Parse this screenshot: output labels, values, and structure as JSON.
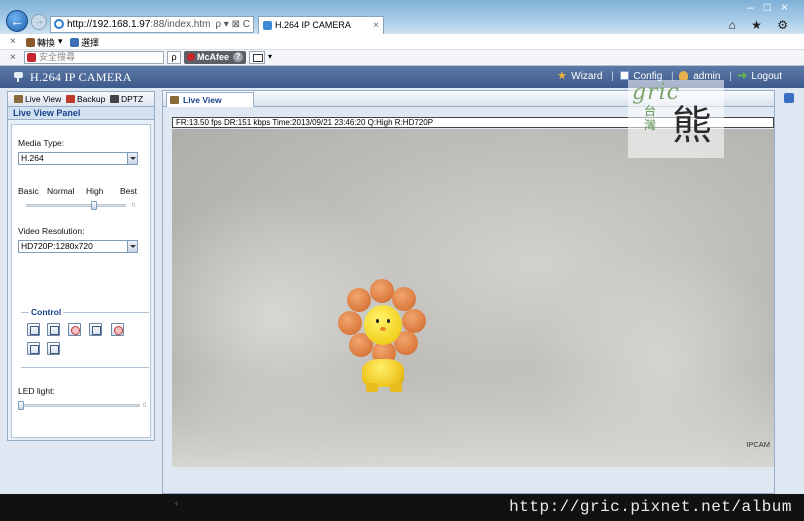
{
  "browser": {
    "address_url": "http://192.168.1.97:88/index.htm",
    "address_host": "http://192.168.1.97",
    "address_rest": ":88/index.htm",
    "address_tools": "ρ ▾ ⊠ C",
    "tab_title": "H.264 IP CAMERA",
    "tab_close": "×",
    "window_controls": {
      "minimize": "–",
      "maximize": "□",
      "close": "×"
    },
    "toolbar_icons": "⌂ ★ ⚙",
    "bar1": {
      "close": "×",
      "item1": "轉換",
      "item2": "選擇",
      "item1_dropdown": "▾"
    },
    "bar2": {
      "close": "×",
      "search_placeholder": "安全搜尋",
      "search_glyph": "ρ",
      "mcafee_label": "McAfee",
      "mcafee_help": "?",
      "dropdown": "▾"
    }
  },
  "app": {
    "title": "H.264 IP CAMERA",
    "header_links": {
      "wizard": "Wizard",
      "config": "Config",
      "admin": "admin",
      "logout": "Logout",
      "sep": "|"
    }
  },
  "left_panel": {
    "tabs": [
      "Live View",
      "Backup",
      "DPTZ"
    ],
    "title": "Live View Panel",
    "media_type_label": "Media Type:",
    "media_type_value": "H.264",
    "quality_labels": [
      "Basic",
      "Normal",
      "High",
      "Best"
    ],
    "quality_level": "High",
    "slider_end": "0",
    "video_resolution_label": "Video Resolution:",
    "video_resolution_value": "HD720P:1280x720",
    "control_legend": "Control",
    "led_label": "LED light:",
    "led_level": 0
  },
  "right_panel": {
    "tab": "Live View",
    "status": "FR:13.50 fps  DR:151 kbps Time:2013/09/21 23:46:20 Q:High R:HD720P",
    "cam_label": "IPCAM"
  },
  "watermark": {
    "gric": "gric",
    "taiwan": "台灣",
    "bear": "熊"
  },
  "footer": {
    "url": "http://gric.pixnet.net/album",
    "scroll_hint": "‹"
  },
  "colors": {
    "header_blue": "#3c5a8c",
    "panel_title": "#15428b",
    "toy_orange": "#d9783c",
    "toy_yellow": "#f1d11f"
  }
}
